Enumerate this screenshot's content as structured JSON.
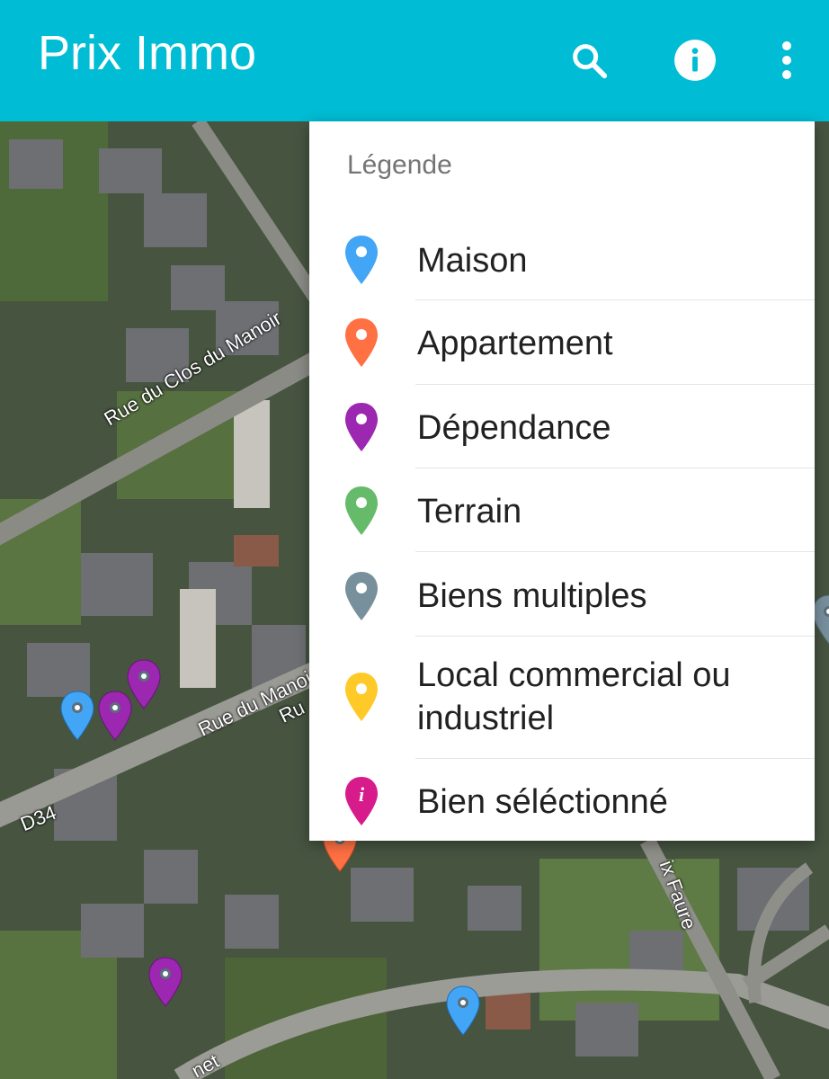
{
  "app": {
    "title": "Prix Immo",
    "accent_color": "#00bcd4",
    "actions": [
      {
        "icon": "search-icon"
      },
      {
        "icon": "info-icon"
      },
      {
        "icon": "more-vert-icon"
      }
    ]
  },
  "legend": {
    "title": "Légende",
    "items": [
      {
        "label": "Maison",
        "color": "#42a5f5",
        "icon": "map-pin-icon"
      },
      {
        "label": "Appartement",
        "color": "#ff7043",
        "icon": "map-pin-icon"
      },
      {
        "label": "Dépendance",
        "color": "#9c27b0",
        "icon": "map-pin-icon"
      },
      {
        "label": "Terrain",
        "color": "#66bb6a",
        "icon": "map-pin-icon"
      },
      {
        "label": "Biens multiples",
        "color": "#78909c",
        "icon": "map-pin-icon"
      },
      {
        "label": "Local commercial ou industriel",
        "color": "#ffca28",
        "icon": "map-pin-icon"
      },
      {
        "label": "Bien séléctionné",
        "color": "#d81b8b",
        "icon": "selected-pin-icon",
        "glyph": "i"
      }
    ]
  },
  "map": {
    "road_labels": [
      "Rue du Clos du Manoir",
      "Rue du Manoi",
      "Ru",
      "D34",
      "ix Faure",
      "net"
    ],
    "markers": [
      {
        "type": "Maison"
      },
      {
        "type": "Dépendance"
      },
      {
        "type": "Dépendance"
      },
      {
        "type": "Dépendance"
      },
      {
        "type": "Maison"
      },
      {
        "type": "Appartement"
      },
      {
        "type": "Biens multiples"
      }
    ]
  }
}
